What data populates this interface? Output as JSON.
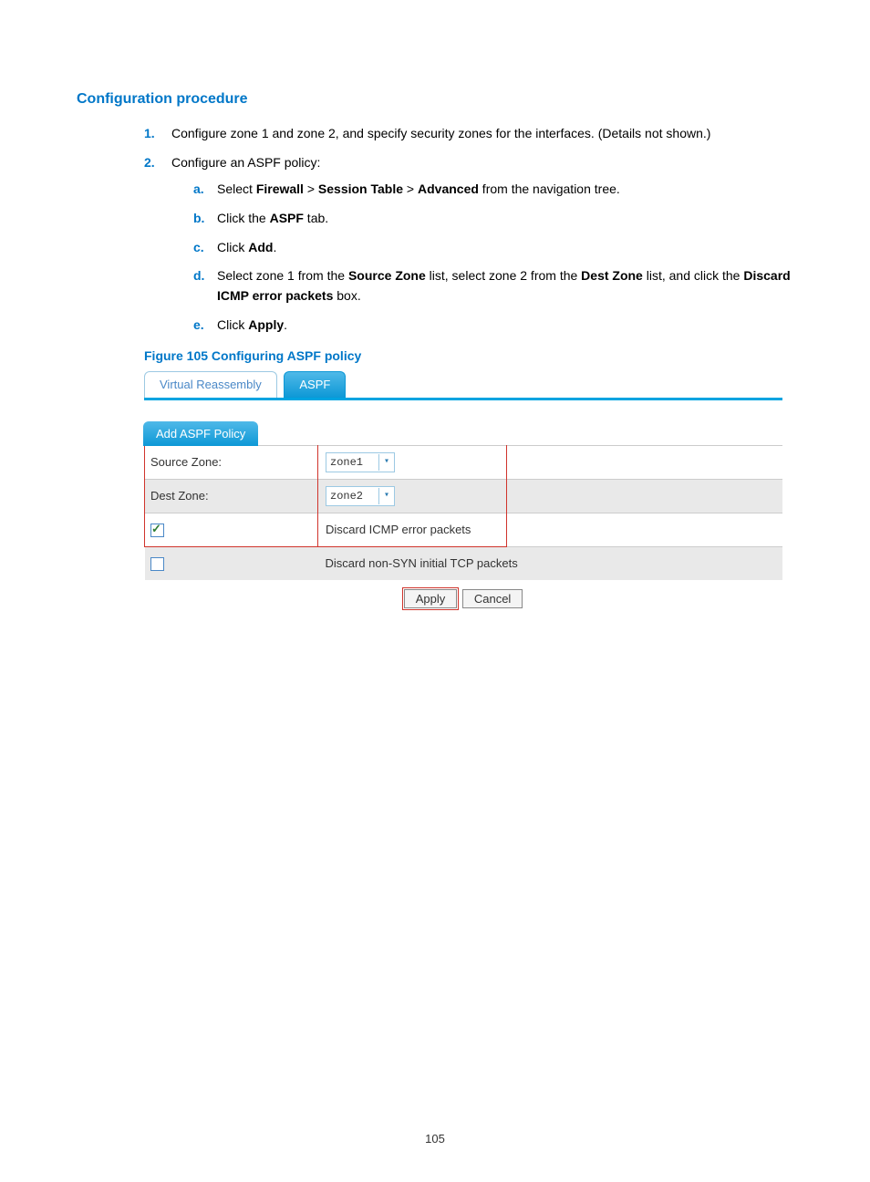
{
  "heading": "Configuration procedure",
  "steps": {
    "s1": {
      "marker": "1.",
      "text": "Configure zone 1 and zone 2, and specify security zones for the interfaces. (Details not shown.)"
    },
    "s2": {
      "marker": "2.",
      "text": "Configure an ASPF policy:",
      "sub": {
        "a": {
          "marker": "a.",
          "pre": "Select ",
          "b1": "Firewall",
          "mid1": " > ",
          "b2": "Session Table",
          "mid2": " > ",
          "b3": "Advanced",
          "post": " from the navigation tree."
        },
        "b": {
          "marker": "b.",
          "pre": "Click the ",
          "b1": "ASPF",
          "post": " tab."
        },
        "c": {
          "marker": "c.",
          "pre": "Click ",
          "b1": "Add",
          "post": "."
        },
        "d": {
          "marker": "d.",
          "pre": "Select zone 1 from the ",
          "b1": "Source Zone",
          "mid1": " list, select zone 2 from the ",
          "b2": "Dest Zone",
          "mid2": " list, and click the ",
          "b3": "Discard ICMP error packets",
          "post": " box."
        },
        "e": {
          "marker": "e.",
          "pre": "Click ",
          "b1": "Apply",
          "post": "."
        }
      }
    }
  },
  "figure_caption": "Figure 105 Configuring ASPF policy",
  "figure": {
    "tab_inactive": "Virtual Reassembly",
    "tab_active": "ASPF",
    "panel_title": "Add ASPF Policy",
    "row1_label": "Source Zone:",
    "row1_value": "zone1",
    "row2_label": "Dest Zone:",
    "row2_value": "zone2",
    "chk1_label": "Discard ICMP error packets",
    "chk2_label": "Discard non-SYN initial TCP packets",
    "btn_apply": "Apply",
    "btn_cancel": "Cancel"
  },
  "page_number": "105"
}
